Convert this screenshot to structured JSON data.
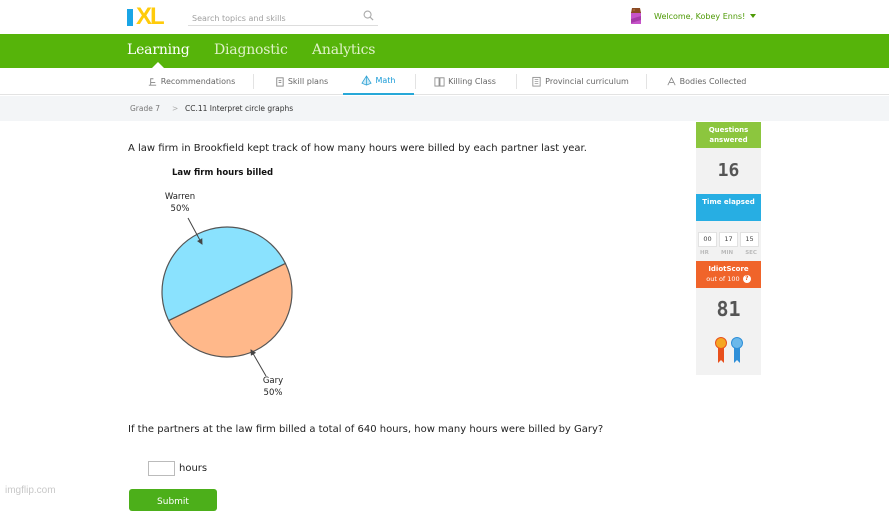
{
  "header": {
    "logo_text": "IXL",
    "search_placeholder": "Search topics and skills",
    "welcome": "Welcome, Kobey Enns!"
  },
  "main_nav": [
    {
      "label": "Learning",
      "active": true
    },
    {
      "label": "Diagnostic",
      "active": false
    },
    {
      "label": "Analytics",
      "active": false
    }
  ],
  "sub_nav": [
    {
      "label": "Recommendations",
      "icon": "chair-icon",
      "active": false
    },
    {
      "label": "Skill plans",
      "icon": "clipboard-icon",
      "active": false
    },
    {
      "label": "Math",
      "icon": "pyramid-icon",
      "active": true
    },
    {
      "label": "Killing Class",
      "icon": "book-icon",
      "active": false
    },
    {
      "label": "Provincial curriculum",
      "icon": "list-icon",
      "active": false
    },
    {
      "label": "Bodies Collected",
      "icon": "award-icon",
      "active": false
    }
  ],
  "breadcrumb": {
    "grade": "Grade 7",
    "separator": ">",
    "skill": "CC.11 Interpret circle graphs"
  },
  "question": {
    "intro": "A law firm in Brookfield kept track of how many hours were billed by each partner last year.",
    "prompt": "If the partners at the law firm billed a total of 640 hours, how many hours were billed by Gary?",
    "answer_value": "",
    "answer_unit": "hours",
    "submit_label": "Submit"
  },
  "chart_data": {
    "type": "pie",
    "title": "Law firm hours billed",
    "categories": [
      "Warren",
      "Gary"
    ],
    "values": [
      50,
      50
    ],
    "labels": [
      "Warren\n50%",
      "Gary\n50%"
    ],
    "colors": [
      "#8ae2fe",
      "#ffb88a"
    ]
  },
  "sidebar": {
    "questions_label": "Questions answered",
    "questions_value": "16",
    "time_label": "Time elapsed",
    "time": {
      "hr": "00",
      "min": "17",
      "sec": "15"
    },
    "time_units": {
      "hr": "HR",
      "min": "MIN",
      "sec": "SEC"
    },
    "score_label": "IdiotScore",
    "score_sub": "out of 100",
    "score_help": "?",
    "score_value": "81"
  },
  "watermark": "imgflip.com"
}
